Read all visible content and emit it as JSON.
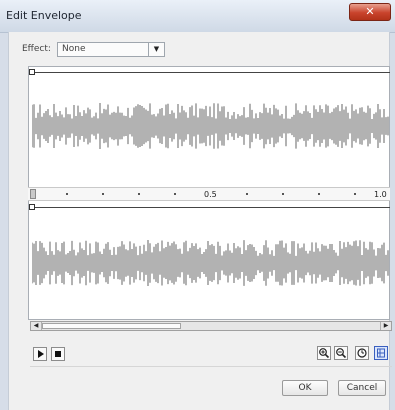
{
  "window": {
    "title": "Edit Envelope",
    "close_symbol": "✕"
  },
  "effect": {
    "label": "Effect:",
    "selected": "None"
  },
  "ruler": {
    "mid_label": "0.5",
    "end_label": "1.0"
  },
  "controls": {
    "play_icon": "play-icon",
    "stop_icon": "stop-icon",
    "zoom_in_icon": "zoom-in-icon",
    "zoom_out_icon": "zoom-out-icon",
    "seconds_icon": "clock-icon",
    "frames_icon": "frames-icon"
  },
  "buttons": {
    "ok": "OK",
    "cancel": "Cancel"
  },
  "colors": {
    "waveform": "#666666",
    "accent": "#3a5fbf"
  }
}
